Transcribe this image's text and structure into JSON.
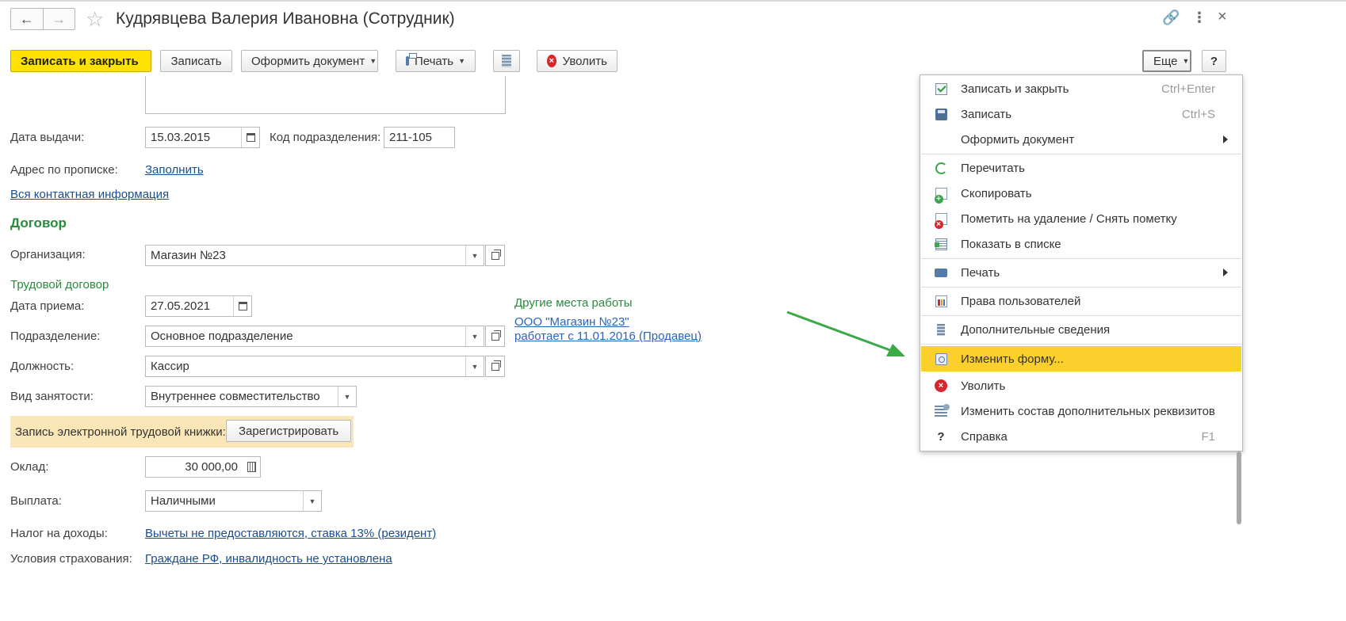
{
  "window": {
    "title": "Кудрявцева Валерия Ивановна (Сотрудник)",
    "back_icon": "←",
    "forward_icon": "→",
    "star_icon": "☆",
    "link_icon": "🔗",
    "more_icon": "⋮",
    "close_icon": "×"
  },
  "toolbar": {
    "save_close": "Записать и закрыть",
    "save": "Записать",
    "make_document": "Оформить документ",
    "print": "Печать",
    "fire": "Уволить",
    "more": "Еще",
    "help": "?"
  },
  "form": {
    "issue_date_label": "Дата выдачи:",
    "issue_date": "15.03.2015",
    "dept_code_label": "Код подразделения:",
    "dept_code": "211-105",
    "address_label": "Адрес по прописке:",
    "address_link": "Заполнить",
    "all_contacts_link": "Вся контактная информация",
    "contract_section": "Договор",
    "org_label": "Организация:",
    "org": "Магазин №23",
    "labor_contract": "Трудовой договор",
    "hire_date_label": "Дата приема:",
    "hire_date": "27.05.2021",
    "other_jobs_title": "Другие места работы",
    "other_job_line1": "ООО \"Магазин №23\"",
    "other_job_line2": "работает с 11.01.2016 (Продавец)",
    "division_label": "Подразделение:",
    "division": "Основное подразделение",
    "position_label": "Должность:",
    "position": "Кассир",
    "employment_type_label": "Вид занятости:",
    "employment_type": "Внутреннее совместительство",
    "etk_label": "Запись электронной трудовой книжки:",
    "etk_button": "Зарегистрировать",
    "salary_label": "Оклад:",
    "salary": "30 000,00",
    "payment_label": "Выплата:",
    "payment": "Наличными",
    "tax_label": "Налог на доходы:",
    "tax_link": "Вычеты не предоставляются, ставка 13% (резидент)",
    "insurance_label": "Условия страхования:",
    "insurance_link": "Граждане РФ, инвалидность не установлена"
  },
  "menu": {
    "items": [
      {
        "label": "Записать и закрыть",
        "shortcut": "Ctrl+Enter",
        "icon": "check-icon"
      },
      {
        "label": "Записать",
        "shortcut": "Ctrl+S",
        "icon": "save-icon"
      },
      {
        "label": "Оформить документ",
        "icon": "none"
      },
      {
        "label": "Перечитать",
        "icon": "refresh-icon"
      },
      {
        "label": "Скопировать",
        "icon": "copy-icon"
      },
      {
        "label": "Пометить на удаление / Снять пометку",
        "icon": "delete-mark-icon"
      },
      {
        "label": "Показать в списке",
        "icon": "list-icon"
      },
      {
        "label": "Печать",
        "icon": "printer-icon"
      },
      {
        "label": "Права пользователей",
        "icon": "rights-icon"
      },
      {
        "label": "Дополнительные сведения",
        "icon": "additional-info-icon"
      },
      {
        "label": "Изменить форму...",
        "icon": "form-settings-icon"
      },
      {
        "label": "Уволить",
        "icon": "fire-icon"
      },
      {
        "label": "Изменить состав дополнительных реквизитов",
        "icon": "attributes-icon"
      },
      {
        "label": "Справка",
        "shortcut": "F1",
        "icon": "help-icon"
      }
    ]
  },
  "colors": {
    "primary_button": "#ffe200",
    "highlight": "#fbd02d",
    "section_green": "#2a8a3e",
    "link_blue": "#1a4d8f",
    "arrow_green": "#3aaa48"
  }
}
